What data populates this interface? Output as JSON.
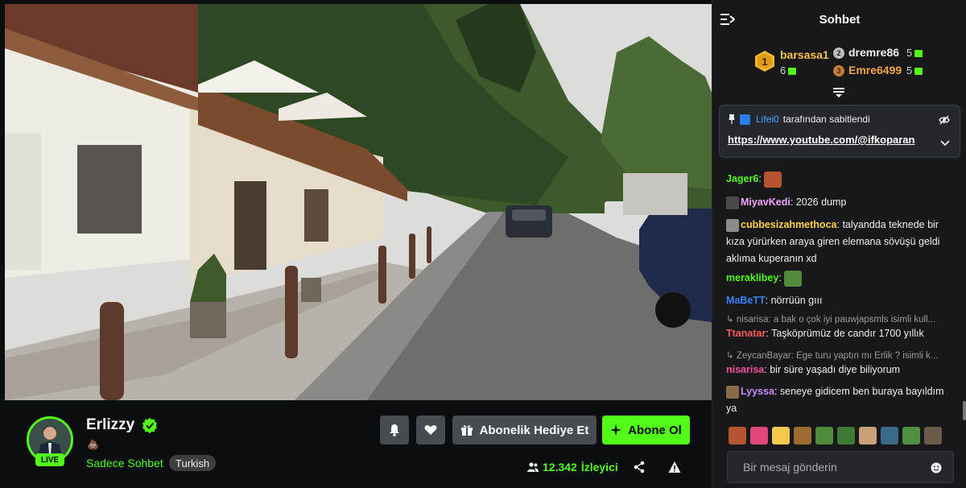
{
  "stream": {
    "streamer_name": "Erlizzy",
    "live_label": "LIVE",
    "title_emoji": "💩",
    "category": "Sadece Sohbet",
    "tag": "Turkish",
    "viewer_count": "12.342",
    "viewer_label": "İzleyici"
  },
  "actions": {
    "gift_label": "Abonelik Hediye Et",
    "subscribe_label": "Abone Ol"
  },
  "chat": {
    "title": "Sohbet",
    "leaderboard": {
      "first": {
        "rank": "1",
        "name": "barsasa1",
        "count": "6"
      },
      "second": {
        "rank": "2",
        "name": "dremre86",
        "count": "5"
      },
      "third": {
        "rank": "3",
        "name": "Emre6499",
        "count": "5"
      }
    },
    "pinned": {
      "user": "Lifei0",
      "by_label": "tarafından sabitlendi",
      "link": "https://www.youtube.com/@ifkoparan"
    },
    "messages": [
      {
        "user": "Jager6",
        "color": "#53fc18",
        "text": ""
      },
      {
        "user": "MiyavKedi",
        "color": "#f0a6ff",
        "text": "2026 dump"
      },
      {
        "user": "cubbesizahmethoca",
        "color": "#ffd24a",
        "text": "talyandda teknede bir kıza yürürken araya giren elemana sövüşü geldi aklıma kuperanın xd"
      },
      {
        "user": "meraklibey",
        "color": "#53fc18",
        "text": ""
      },
      {
        "user": "MaBeTT",
        "color": "#3b82f6",
        "text": "nörrüün gııı"
      },
      {
        "reply": "nisarisa: a bak o çok iyi pauwjapsmls isimli kull...",
        "user": "Ttanatar",
        "color": "#ff5a5a",
        "text": "Taşköprümüz de candır 1700 yıllık"
      },
      {
        "reply": "ZeycanBayar: Ege turu yaptın mı Erlik ? isimli k...",
        "user": "nisarisa",
        "color": "#ff4fa0",
        "text": "bir süre yaşadı diye biliyorum"
      },
      {
        "user": "Lyyssa",
        "color": "#c78bff",
        "text": "seneye gidicem ben buraya bayıldım ya"
      }
    ],
    "input_placeholder": "Bir mesaj gönderin"
  },
  "colors": {
    "accent": "#53fc18",
    "background": "#0b0e0f",
    "chat_bg": "#18181b"
  }
}
